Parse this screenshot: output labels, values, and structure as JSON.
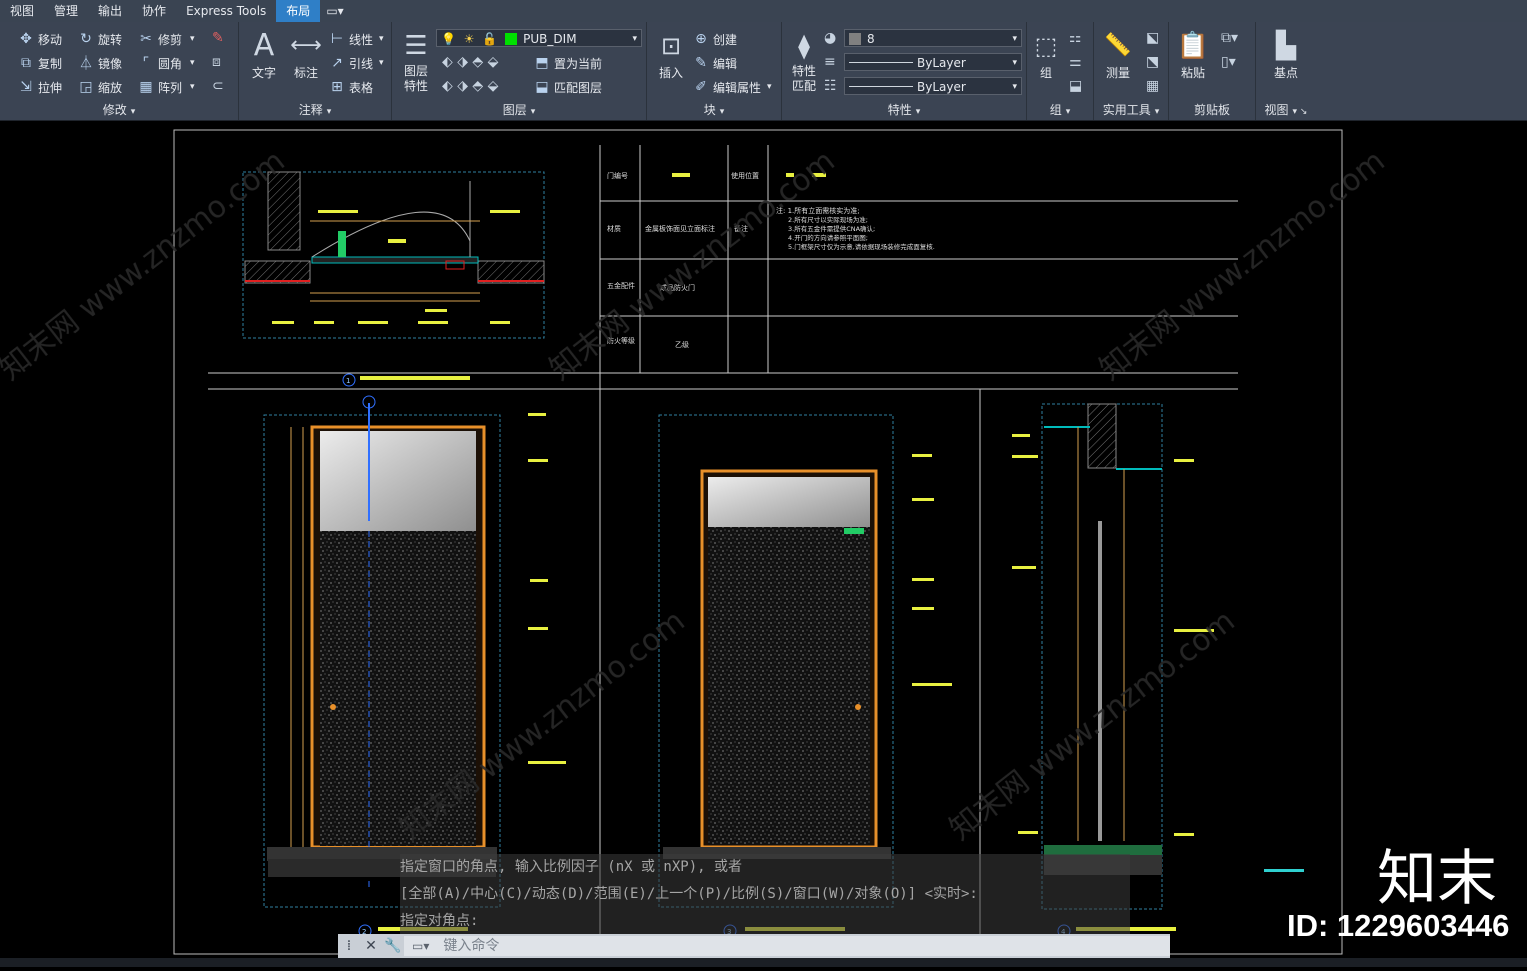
{
  "menu": {
    "tabs": [
      "视图",
      "管理",
      "输出",
      "协作",
      "Express Tools",
      "布局"
    ],
    "active_tab": "布局",
    "extra": "▭▾"
  },
  "ribbon": {
    "modify": {
      "label": "修改",
      "tools": [
        "移动",
        "旋转",
        "修剪",
        "复制",
        "镜像",
        "圆角",
        "拉伸",
        "缩放",
        "阵列"
      ]
    },
    "annotation": {
      "label": "注释",
      "text": "文字",
      "dimension": "标注",
      "linear": "线性",
      "leader": "引线",
      "table": "表格"
    },
    "layers": {
      "label": "图层",
      "properties": "图层\n特性",
      "current_layer": "PUB_DIM",
      "current_layer_color": "#00e000",
      "set_current": "置为当前",
      "match_layer": "匹配图层"
    },
    "insert": {
      "label": "插入"
    },
    "block": {
      "label": "块",
      "create": "创建",
      "edit": "编辑",
      "edit_attr": "编辑属性"
    },
    "properties": {
      "label": "特性",
      "match": "特性\n匹配",
      "color": "8",
      "linetype": "ByLayer",
      "lineweight": "ByLayer"
    },
    "group": {
      "label": "组",
      "group": "组"
    },
    "utilities": {
      "label": "实用工具",
      "measure": "测量"
    },
    "clipboard": {
      "label": "剪贴板",
      "paste": "粘贴"
    },
    "view": {
      "label": "视图",
      "basepoint": "基点"
    }
  },
  "drawing": {
    "table": {
      "door_no": "门编号",
      "location": "使用位置",
      "material": "材质",
      "material_val": "金属板饰面见立面标注",
      "remark": "备注",
      "hardware": "五金配件",
      "hardware_val": "成品防火门",
      "fire_rating": "防火等级",
      "fire_rating_val": "乙级",
      "notes_title": "注: 1.所有立面需核实为准;",
      "notes": [
        "2.所有尺寸以实际现场为准;",
        "3.所有五金件需提供CNA确认;",
        "4.开门的方向请参照平面图;",
        "5.门框架尺寸仅为示意,请依据现场装修完成面复核."
      ]
    },
    "titles": [
      "1",
      "2",
      "3",
      "4"
    ],
    "watermark": "知末网 www.znzmo.com"
  },
  "command": {
    "lines": [
      "指定窗口的角点, 输入比例因子 (nX 或 nXP), 或者",
      "[全部(A)/中心(C)/动态(D)/范围(E)/上一个(P)/比例(S)/窗口(W)/对象(O)] <实时>:",
      "指定对角点:"
    ],
    "placeholder": "键入命令"
  },
  "brand": {
    "name": "知末",
    "id": "ID: 1229603446"
  }
}
